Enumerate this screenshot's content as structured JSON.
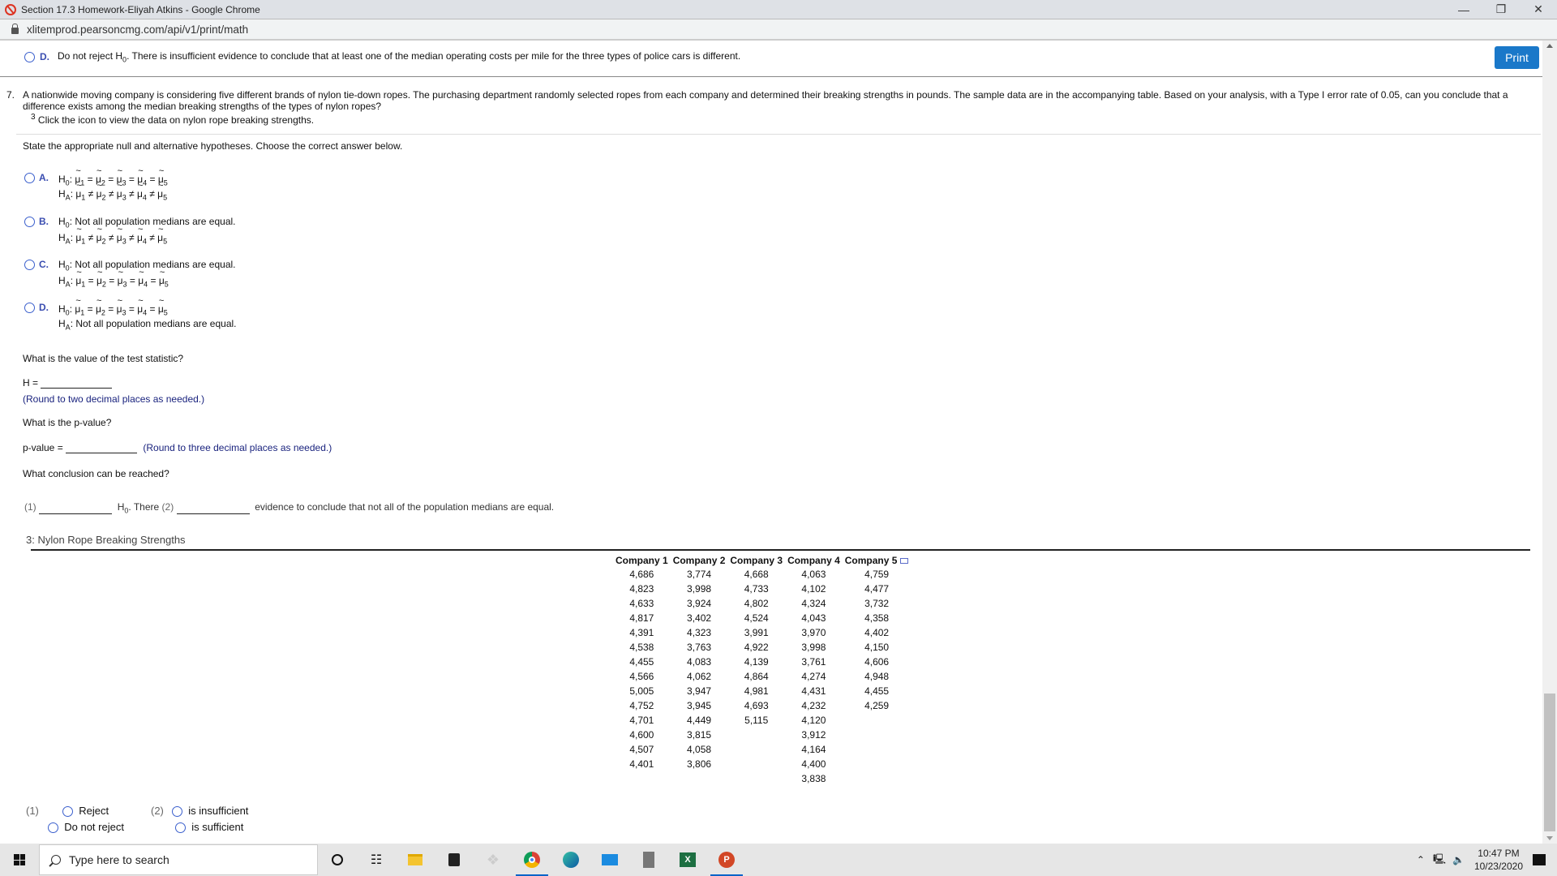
{
  "window": {
    "title": "Section 17.3 Homework-Eliyah Atkins - Google Chrome",
    "url": "xlitemprod.pearsoncmg.com/api/v1/print/math",
    "controls": [
      "minimize",
      "restore",
      "close"
    ]
  },
  "previous_answer": {
    "label": "D.",
    "text_before": "Do not reject H",
    "sub": "0",
    "text_after": ". There is insufficient evidence to conclude that at least one of the median operating costs per mile for the three types of police cars is different."
  },
  "print_button": "Print",
  "question": {
    "number": "7.",
    "text": "A nationwide moving company is considering five different brands of nylon tie-down ropes. The purchasing department randomly selected ropes from each company and determined their breaking strengths in pounds. The sample data are in the accompanying table. Based on your analysis, with a Type I error rate of 0.05, can you conclude that a difference exists among the median breaking strengths of the types of nylon ropes?",
    "footnote_mark": "3",
    "footnote": "Click the icon to view the data on nylon rope breaking strengths."
  },
  "hypotheses": {
    "prompt": "State the appropriate null and alternative hypotheses. Choose the correct answer below.",
    "options": [
      {
        "label": "A.",
        "h0": "equal",
        "ha": "notequal"
      },
      {
        "label": "B.",
        "h0_text": "Not all population medians are equal.",
        "ha": "notequal"
      },
      {
        "label": "C.",
        "h0_text": "Not all population medians are equal.",
        "ha": "equal"
      },
      {
        "label": "D.",
        "h0": "equal",
        "ha_text": "Not all population medians are equal."
      }
    ],
    "h0_label": "H",
    "h0_sub": "0",
    "ha_label": "H",
    "ha_sub": "A"
  },
  "test_statistic": {
    "prompt": "What is the value of the test statistic?",
    "label": "H =",
    "value": "",
    "hint": "(Round to two decimal places as needed.)"
  },
  "p_value": {
    "prompt": "What is the p-value?",
    "label": "p-value =",
    "value": "",
    "hint": "(Round to three decimal places as needed.)"
  },
  "conclusion": {
    "prompt": "What conclusion can be reached?",
    "part1": "(1)",
    "h0": "H",
    "h0_sub": "0",
    "there": ". There",
    "part2": "(2)",
    "tail": "evidence to conclude that not all of the population medians are equal."
  },
  "data_table": {
    "title": "3: Nylon Rope Breaking Strengths",
    "headers": [
      "Company 1",
      "Company 2",
      "Company 3",
      "Company 4",
      "Company 5"
    ],
    "columns": [
      [
        "4,686",
        "4,823",
        "4,633",
        "4,817",
        "4,391",
        "4,538",
        "4,455",
        "4,566",
        "5,005",
        "4,752",
        "4,701",
        "4,600",
        "4,507",
        "4,401"
      ],
      [
        "3,774",
        "3,998",
        "3,924",
        "3,402",
        "4,323",
        "3,763",
        "4,083",
        "4,062",
        "3,947",
        "3,945",
        "4,449",
        "3,815",
        "4,058",
        "3,806"
      ],
      [
        "4,668",
        "4,733",
        "4,802",
        "4,524",
        "3,991",
        "4,922",
        "4,139",
        "4,864",
        "4,981",
        "4,693",
        "5,115"
      ],
      [
        "4,063",
        "4,102",
        "4,324",
        "4,043",
        "3,970",
        "3,998",
        "3,761",
        "4,274",
        "4,431",
        "4,232",
        "4,120",
        "3,912",
        "4,164",
        "4,400",
        "3,838"
      ],
      [
        "4,759",
        "4,477",
        "3,732",
        "4,358",
        "4,402",
        "4,150",
        "4,606",
        "4,948",
        "4,455",
        "4,259"
      ]
    ]
  },
  "answer_choices": {
    "group1_label": "(1)",
    "group1": [
      "Reject",
      "Do not reject"
    ],
    "group2_label": "(2)",
    "group2": [
      "is insufficient",
      "is sufficient"
    ]
  },
  "taskbar": {
    "search_placeholder": "Type here to search",
    "apps": [
      "cortana",
      "task-view",
      "file-explorer",
      "store",
      "dropbox",
      "chrome",
      "edge",
      "mail",
      "calculator",
      "excel",
      "powerpoint"
    ],
    "time": "10:47 PM",
    "date": "10/23/2020"
  },
  "colors": {
    "accent_blue": "#1a78c9",
    "radio_blue": "#3a5fcd",
    "hint_blue": "#1a237e"
  }
}
